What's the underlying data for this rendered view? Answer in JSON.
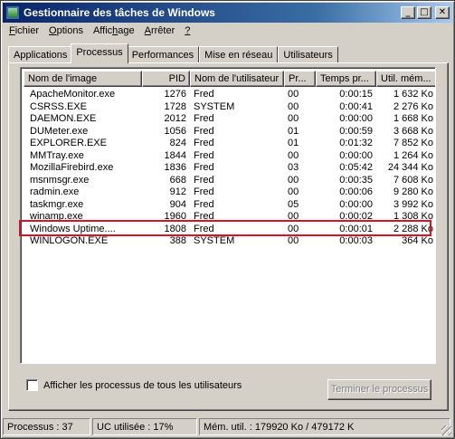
{
  "window": {
    "title": "Gestionnaire des tâches de Windows",
    "minimize": "_",
    "maximize": "□",
    "close": "✕"
  },
  "menu": [
    {
      "pre": "",
      "key": "F",
      "rest": "ichier"
    },
    {
      "pre": "",
      "key": "O",
      "rest": "ptions"
    },
    {
      "pre": "Affic",
      "key": "h",
      "rest": "age"
    },
    {
      "pre": "",
      "key": "A",
      "rest": "rrêter"
    },
    {
      "pre": "",
      "key": "?",
      "rest": ""
    }
  ],
  "tabs": [
    "Applications",
    "Processus",
    "Performances",
    "Mise en réseau",
    "Utilisateurs"
  ],
  "active_tab": "Processus",
  "columns": [
    "Nom de l'image",
    "PID",
    "Nom de l'utilisateur",
    "Pr...",
    "Temps pr...",
    "Util. mém..."
  ],
  "rows": [
    [
      "ApacheMonitor.exe",
      "1276",
      "Fred",
      "00",
      "0:00:15",
      "1 632 Ko"
    ],
    [
      "CSRSS.EXE",
      "1728",
      "SYSTEM",
      "00",
      "0:00:41",
      "2 276 Ko"
    ],
    [
      "DAEMON.EXE",
      "2012",
      "Fred",
      "00",
      "0:00:00",
      "1 668 Ko"
    ],
    [
      "DUMeter.exe",
      "1056",
      "Fred",
      "01",
      "0:00:59",
      "3 668 Ko"
    ],
    [
      "EXPLORER.EXE",
      "824",
      "Fred",
      "01",
      "0:01:32",
      "7 852 Ko"
    ],
    [
      "MMTray.exe",
      "1844",
      "Fred",
      "00",
      "0:00:00",
      "1 264 Ko"
    ],
    [
      "MozillaFirebird.exe",
      "1836",
      "Fred",
      "03",
      "0:05:42",
      "24 344 Ko"
    ],
    [
      "msnmsgr.exe",
      "668",
      "Fred",
      "00",
      "0:00:35",
      "7 608 Ko"
    ],
    [
      "radmin.exe",
      "912",
      "Fred",
      "00",
      "0:00:06",
      "9 280 Ko"
    ],
    [
      "taskmgr.exe",
      "904",
      "Fred",
      "05",
      "0:00:00",
      "3 992 Ko"
    ],
    [
      "winamp.exe",
      "1960",
      "Fred",
      "00",
      "0:00:02",
      "1 308 Ko"
    ],
    [
      "Windows Uptime....",
      "1808",
      "Fred",
      "00",
      "0:00:01",
      "2 288 Ko"
    ],
    [
      "WINLOGON.EXE",
      "388",
      "SYSTEM",
      "00",
      "0:00:03",
      "364 Ko"
    ]
  ],
  "highlighted_process": "winamp.exe",
  "highlight_color": "#e01020",
  "show_all_label": "Afficher les processus de tous les utilisateurs",
  "end_process_label": "Terminer le processus",
  "status": {
    "processes": "Processus : 37",
    "cpu": "UC utilisée : 17%",
    "memory": "Mém. util. : 179920 Ko / 479172 K"
  }
}
